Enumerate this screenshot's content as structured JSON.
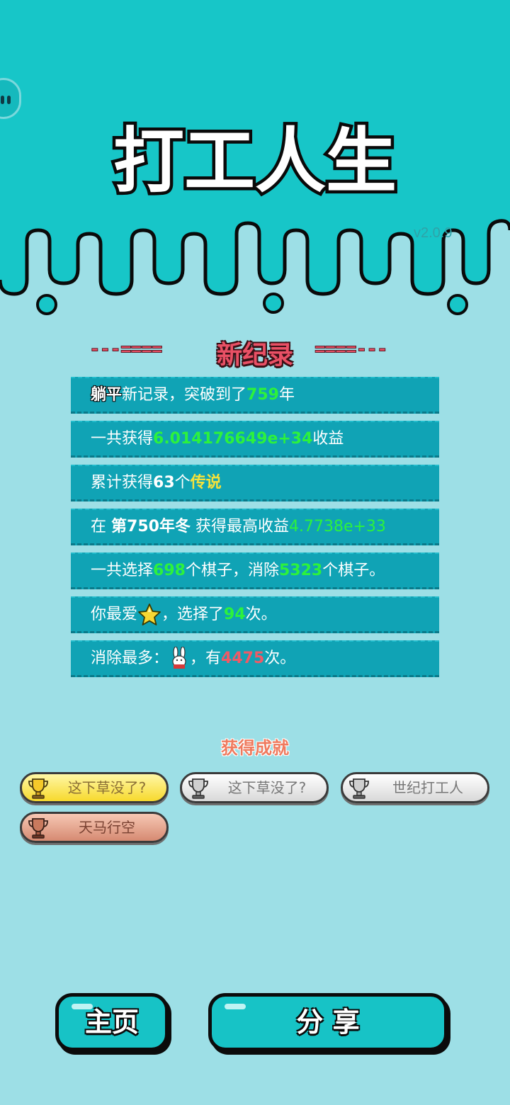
{
  "game": {
    "title": "打工人生",
    "version": "v2.0.9"
  },
  "record": {
    "dash_left": "---====",
    "heading": "新纪录",
    "dash_right": "====---"
  },
  "stats": {
    "row1": {
      "bold": "躺平",
      "text1": "新记录，突破到了",
      "value": "759",
      "text2": "年"
    },
    "row2": {
      "text1": "一共获得",
      "value": "6.014176649e+34",
      "text2": "收益"
    },
    "row3": {
      "text1": "累计获得",
      "count": "63",
      "text2": "个",
      "rarity": "传说"
    },
    "row4": {
      "text1": "在",
      "period": "第750年冬",
      "text2": "获得最高收益",
      "value": "4.7738e+33"
    },
    "row5": {
      "text1": "一共选择",
      "selected": "698",
      "text2": "个棋子，消除",
      "eliminated": "5323",
      "text3": "个棋子。"
    },
    "row6": {
      "text1": "你最爱",
      "icon": "star-icon",
      "text2": "，选择了",
      "count": "94",
      "text3": "次。"
    },
    "row7": {
      "text1": "消除最多：",
      "icon": "rabbit-icon",
      "text2": "，有",
      "count": "4475",
      "text3": "次。"
    }
  },
  "achievements": {
    "heading": "获得成就",
    "items": [
      {
        "label": "这下草没了?",
        "tier": "gold"
      },
      {
        "label": "这下草没了?",
        "tier": "silver"
      },
      {
        "label": "世纪打工人",
        "tier": "silver"
      },
      {
        "label": "天马行空",
        "tier": "bronze"
      }
    ]
  },
  "buttons": {
    "home": "主页",
    "share": "分 享"
  },
  "colors": {
    "header": "#17c6c8",
    "background": "#9ddfe6",
    "panel": "#10a3b5",
    "highlight_green": "#2cf23c",
    "highlight_yellow": "#f6e23a",
    "highlight_red": "#f05a66"
  }
}
